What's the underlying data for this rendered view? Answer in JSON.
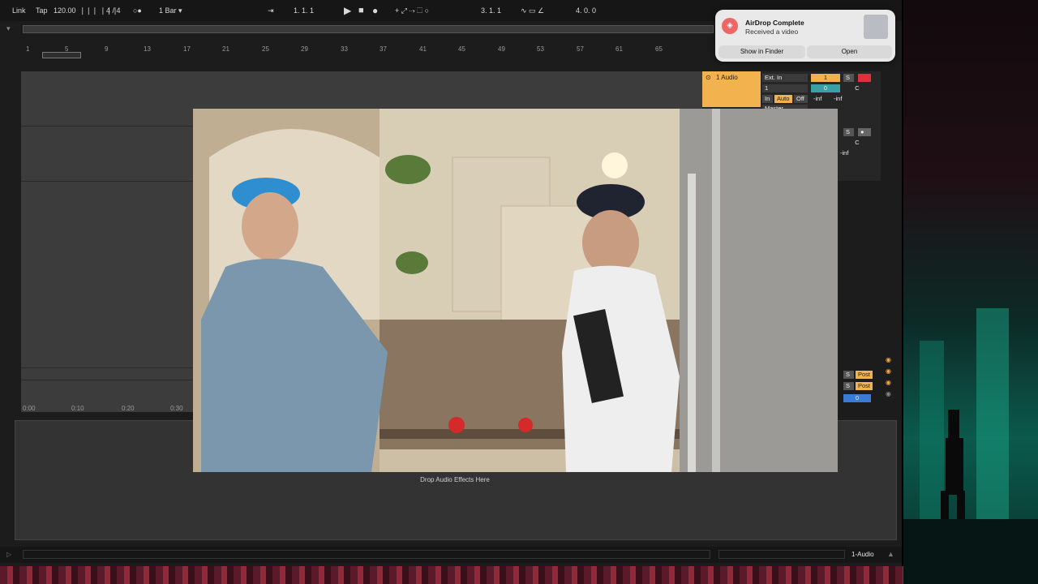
{
  "transport": {
    "link": "Link",
    "tap": "Tap",
    "tempo": "120.00",
    "signature": "4 / 4",
    "quantize": "1 Bar",
    "arrangement_position": "1.  1.  1",
    "loop_start": "3.  1.  1",
    "loop_length": "4.  0.  0"
  },
  "ruler": {
    "bars": [
      "1",
      "5",
      "9",
      "13",
      "17",
      "21",
      "25",
      "29",
      "33",
      "37",
      "41",
      "45",
      "49",
      "53",
      "57",
      "61",
      "65"
    ]
  },
  "timeline": {
    "marks": [
      "0:00",
      "0:10",
      "0:20",
      "0:30"
    ]
  },
  "mixer": {
    "track_name": "1 Audio",
    "input_type": "Ext. In",
    "input_channel": "1",
    "track_number": "1",
    "solo": "S",
    "volume": "0",
    "pan": "C",
    "monitor": [
      "In",
      "Auto",
      "Off"
    ],
    "meter_left": "-inf",
    "meter_right": "-inf",
    "output": "Master",
    "return_pan": "C",
    "return_meter": "-inf",
    "sends": [
      "Post",
      "Post"
    ],
    "master_volume": "0"
  },
  "device": {
    "drop_label": "Drop Audio Effects Here"
  },
  "status": {
    "selected_track": "1-Audio"
  },
  "notification": {
    "title": "AirDrop Complete",
    "subtitle": "Received a video",
    "button_show": "Show in Finder",
    "button_open": "Open"
  },
  "colors": {
    "track_accent": "#f2b24e",
    "record_red": "#e0303b",
    "blue_value": "#3a7bd5"
  }
}
